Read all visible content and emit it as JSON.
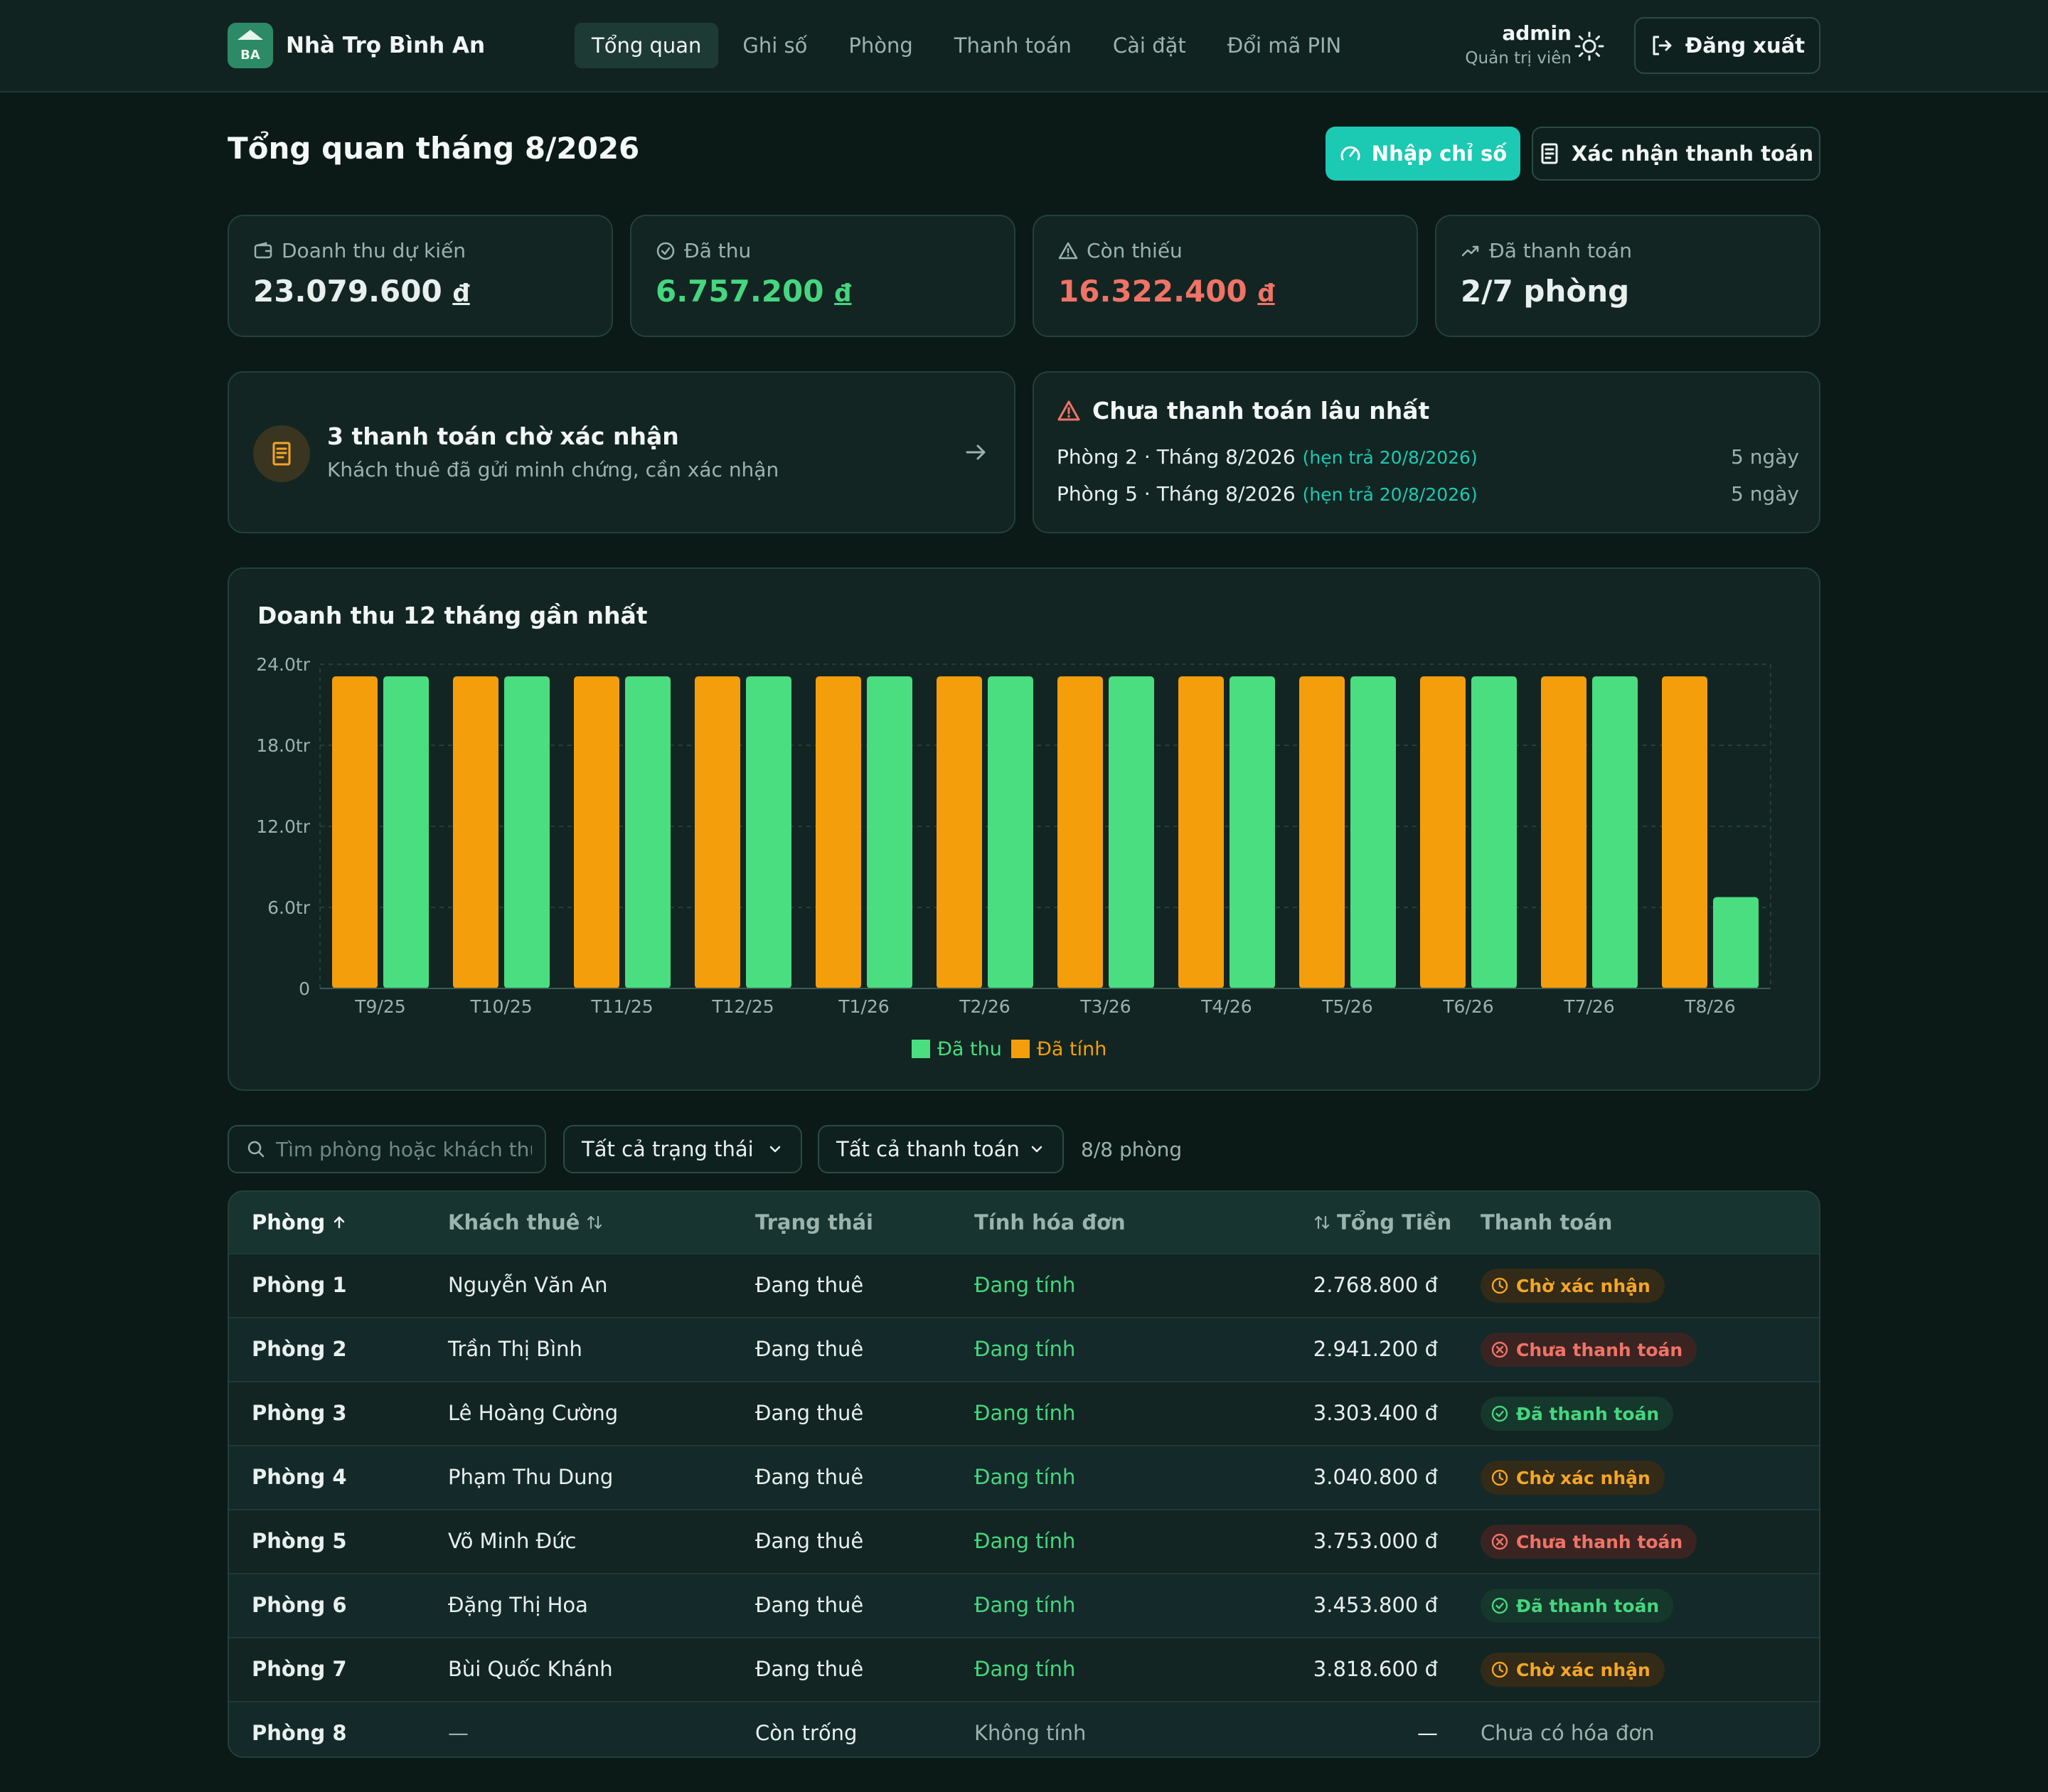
{
  "app": {
    "logo_text": "BA",
    "name": "Nhà Trọ Bình An"
  },
  "nav": [
    "Tổng quan",
    "Ghi số",
    "Phòng",
    "Thanh toán",
    "Cài đặt",
    "Đổi mã PIN"
  ],
  "user": {
    "name": "admin",
    "role": "Quản trị viên",
    "logout": "Đăng xuất"
  },
  "page": {
    "title": "Tổng quan tháng 8/2026",
    "btn_primary": "Nhập chỉ số",
    "btn_secondary": "Xác nhận thanh toán"
  },
  "stats": [
    {
      "label": "Doanh thu dự kiến",
      "value": "23.079.600",
      "currency": "đ",
      "icon": "wallet-icon"
    },
    {
      "label": "Đã thu",
      "value": "6.757.200",
      "currency": "đ",
      "icon": "check-circle-icon"
    },
    {
      "label": "Còn thiếu",
      "value": "16.322.400",
      "currency": "đ",
      "icon": "warning-icon"
    },
    {
      "label": "Đã thanh toán",
      "value": "2/7 phòng",
      "icon": "trend-up-icon"
    }
  ],
  "pending": {
    "title": "3 thanh toán chờ xác nhận",
    "subtitle": "Khách thuê đã gửi minh chứng, cần xác nhận"
  },
  "overdue": {
    "title": "Chưa thanh toán lâu nhất",
    "items": [
      {
        "label": "Phòng 2 · Tháng 8/2026",
        "due": "(hẹn trả 20/8/2026)",
        "days": "5 ngày"
      },
      {
        "label": "Phòng 5 · Tháng 8/2026",
        "due": "(hẹn trả 20/8/2026)",
        "days": "5 ngày"
      }
    ]
  },
  "chart_data": {
    "type": "bar",
    "title": "Doanh thu 12 tháng gần nhất",
    "categories": [
      "T9/25",
      "T10/25",
      "T11/25",
      "T12/25",
      "T1/26",
      "T2/26",
      "T3/26",
      "T4/26",
      "T5/26",
      "T6/26",
      "T7/26",
      "T8/26"
    ],
    "series": [
      {
        "name": "Đã tính",
        "color": "#f59e0b",
        "values": [
          23.1,
          23.1,
          23.1,
          23.1,
          23.1,
          23.1,
          23.1,
          23.1,
          23.1,
          23.1,
          23.1,
          23.1
        ]
      },
      {
        "name": "Đã thu",
        "color": "#4ade80",
        "values": [
          23.1,
          23.1,
          23.1,
          23.1,
          23.1,
          23.1,
          23.1,
          23.1,
          23.1,
          23.1,
          23.1,
          6.76
        ]
      }
    ],
    "ylim": [
      0,
      24
    ],
    "yticks": [
      "0",
      "6.0tr",
      "12.0tr",
      "18.0tr",
      "24.0tr"
    ],
    "ytick_values": [
      0,
      6,
      12,
      18,
      24
    ],
    "legend": [
      "Đã thu",
      "Đã tính"
    ],
    "legend_position": "bottom-center",
    "grid": true
  },
  "filters": {
    "search_placeholder": "Tìm phòng hoặc khách thuê",
    "status": "Tất cả trạng thái",
    "payment": "Tất cả thanh toán",
    "count": "8/8 phòng"
  },
  "table": {
    "headers": {
      "room": "Phòng",
      "tenant": "Khách thuê",
      "status": "Trạng thái",
      "billing": "Tính hóa đơn",
      "total": "Tổng Tiền",
      "payment": "Thanh toán"
    },
    "rows": [
      {
        "room": "Phòng 1",
        "tenant": "Nguyễn Văn An",
        "status": "Đang thuê",
        "billing": "Đang tính",
        "total": "2.768.800 đ",
        "payment": "Chờ xác nhận",
        "ptype": "wait"
      },
      {
        "room": "Phòng 2",
        "tenant": "Trần Thị Bình",
        "status": "Đang thuê",
        "billing": "Đang tính",
        "total": "2.941.200 đ",
        "payment": "Chưa thanh toán",
        "ptype": "unpaid"
      },
      {
        "room": "Phòng 3",
        "tenant": "Lê Hoàng Cường",
        "status": "Đang thuê",
        "billing": "Đang tính",
        "total": "3.303.400 đ",
        "payment": "Đã thanh toán",
        "ptype": "paid"
      },
      {
        "room": "Phòng 4",
        "tenant": "Phạm Thu Dung",
        "status": "Đang thuê",
        "billing": "Đang tính",
        "total": "3.040.800 đ",
        "payment": "Chờ xác nhận",
        "ptype": "wait"
      },
      {
        "room": "Phòng 5",
        "tenant": "Võ Minh Đức",
        "status": "Đang thuê",
        "billing": "Đang tính",
        "total": "3.753.000 đ",
        "payment": "Chưa thanh toán",
        "ptype": "unpaid"
      },
      {
        "room": "Phòng 6",
        "tenant": "Đặng Thị Hoa",
        "status": "Đang thuê",
        "billing": "Đang tính",
        "total": "3.453.800 đ",
        "payment": "Đã thanh toán",
        "ptype": "paid"
      },
      {
        "room": "Phòng 7",
        "tenant": "Bùi Quốc Khánh",
        "status": "Đang thuê",
        "billing": "Đang tính",
        "total": "3.818.600 đ",
        "payment": "Chờ xác nhận",
        "ptype": "wait"
      },
      {
        "room": "Phòng 8",
        "tenant": "—",
        "status": "Còn trống",
        "billing": "Không tính",
        "total": "—",
        "payment": "Chưa có hóa đơn",
        "ptype": "none"
      }
    ]
  }
}
